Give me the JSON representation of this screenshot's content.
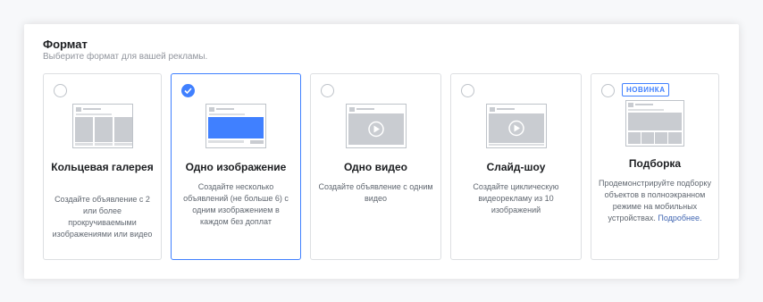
{
  "section": {
    "title": "Формат",
    "subtitle": "Выберите формат для вашей рекламы."
  },
  "colors": {
    "accent": "#4080ff",
    "border": "#dddfe2",
    "text": "#1c1e21",
    "muted": "#606770",
    "thumb": "#c9ccd1"
  },
  "cards": [
    {
      "id": "carousel",
      "title": "Кольцевая галерея",
      "description": "Создайте объявление с 2 или более прокручиваемыми изображениями или видео",
      "selected": false,
      "icon": "carousel-preview-icon"
    },
    {
      "id": "single-image",
      "title": "Одно изображение",
      "description": "Создайте несколько объявлений (не больше 6) с одним изображением в каждом без доплат",
      "selected": true,
      "icon": "single-image-preview-icon"
    },
    {
      "id": "single-video",
      "title": "Одно видео",
      "description": "Создайте объявление с одним видео",
      "selected": false,
      "icon": "video-preview-icon"
    },
    {
      "id": "slideshow",
      "title": "Слайд-шоу",
      "description": "Создайте циклическую видеорекламу из 10 изображений",
      "selected": false,
      "icon": "slideshow-preview-icon"
    },
    {
      "id": "collection",
      "title": "Подборка",
      "badge": "НОВИНКА",
      "description": "Продемонстрируйте подборку объектов в полноэкранном режиме на мобильных устройствах.",
      "link": "Подробнее.",
      "selected": false,
      "icon": "collection-preview-icon"
    }
  ]
}
